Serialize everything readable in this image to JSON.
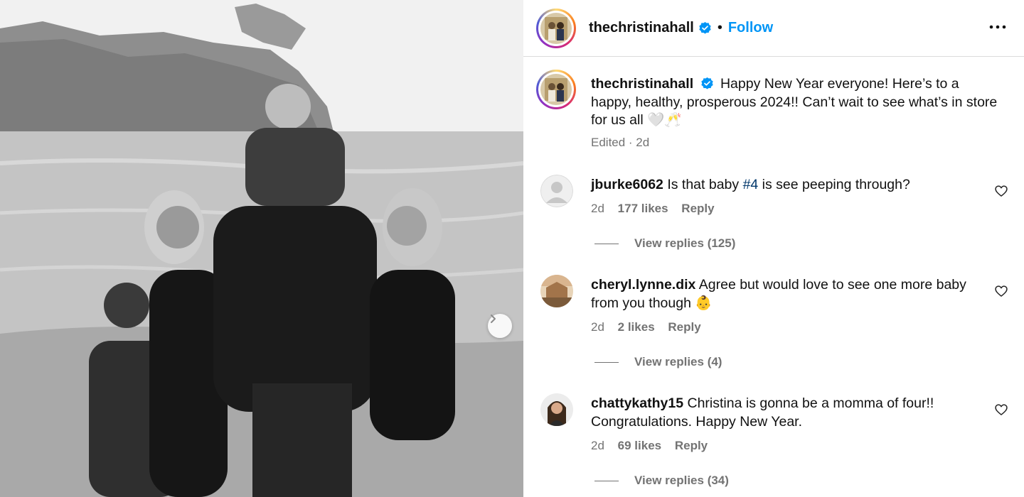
{
  "post": {
    "username": "thechristinahall",
    "follow_label": "Follow",
    "separator": "•",
    "caption": "Happy New Year everyone! Here’s to a happy, healthy, prosperous 2024!! Can’t wait to see what’s in store for us all 🤍🥂",
    "edited_label": "Edited · 2d"
  },
  "comments": [
    {
      "username": "jburke6062",
      "text_before": "Is that baby ",
      "hashtag": "#4",
      "text_after": " is see peeping through?",
      "age": "2d",
      "likes": "177 likes",
      "reply_label": "Reply",
      "view_replies": "View replies (125)"
    },
    {
      "username": "cheryl.lynne.dix",
      "text": "Agree but would love to see one more baby from you though 👶",
      "age": "2d",
      "likes": "2 likes",
      "reply_label": "Reply",
      "view_replies": "View replies (4)"
    },
    {
      "username": "chattykathy15",
      "text": "Christina is gonna be a momma of four!! Congratulations. Happy New Year.",
      "age": "2d",
      "likes": "69 likes",
      "reply_label": "Reply",
      "view_replies": "View replies (34)"
    }
  ],
  "colors": {
    "follow": "#0095f6",
    "verified": "#0095f6",
    "meta": "#737373",
    "hashtag": "#00376b"
  },
  "icons": {
    "verified": "verified-badge-icon",
    "more": "more-options-icon",
    "like": "heart-outline-icon",
    "next": "chevron-right-icon"
  }
}
